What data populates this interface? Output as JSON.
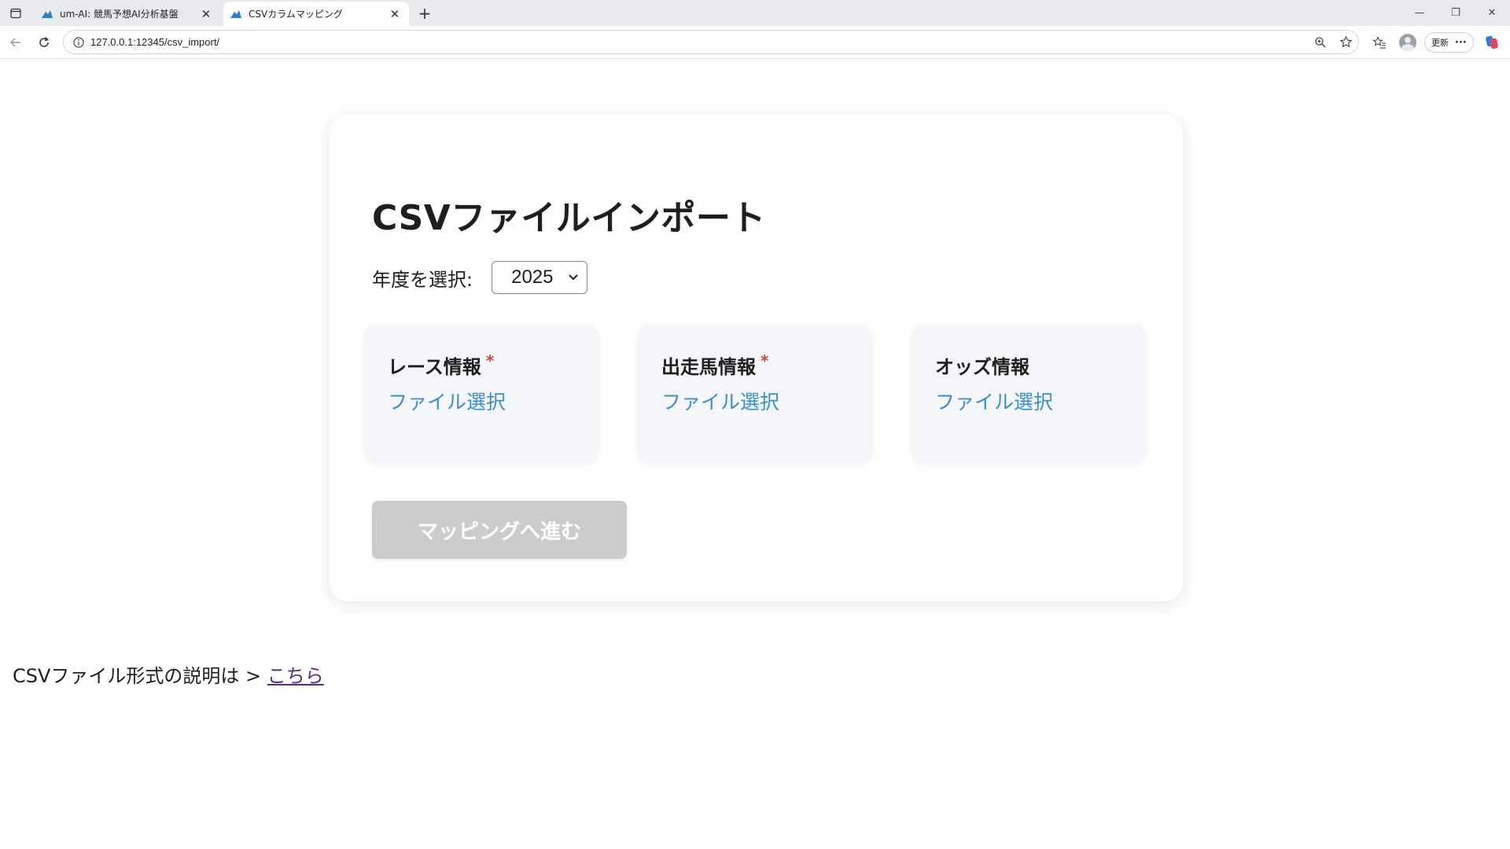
{
  "browser": {
    "tabs": [
      {
        "title": "um-AI: 競馬予想AI分析基盤",
        "active": false
      },
      {
        "title": "CSVカラムマッピング",
        "active": true
      }
    ],
    "address_url": "127.0.0.1:12345/csv_import/",
    "update_label": "更新",
    "more_label": "···"
  },
  "page": {
    "title": "CSVファイルインポート",
    "year_label": "年度を選択:",
    "year_selected": "2025",
    "upload_boxes": [
      {
        "label": "レース情報",
        "required_mark": "*",
        "file_select": "ファイル選択"
      },
      {
        "label": "出走馬情報",
        "required_mark": "*",
        "file_select": "ファイル選択"
      },
      {
        "label": "オッズ情報",
        "required_mark": "",
        "file_select": "ファイル選択"
      }
    ],
    "proceed_button": "マッピングへ進む",
    "help_text": "CSVファイル形式の説明は > ",
    "help_link": "こちら"
  },
  "colors": {
    "link_blue": "#3c8fc4",
    "required_red": "#c04848",
    "disabled_button": "#cccccc",
    "visited_link": "#5a2a82"
  }
}
